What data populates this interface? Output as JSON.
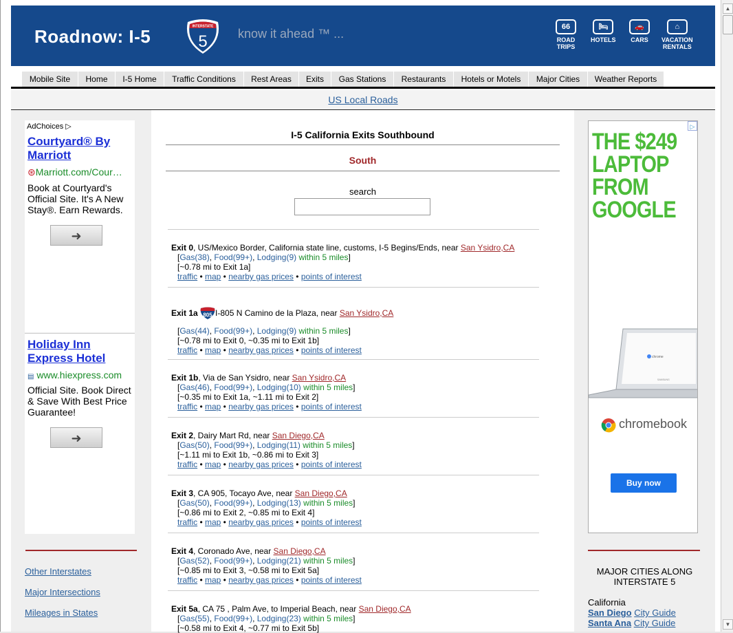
{
  "header": {
    "title": "Roadnow: I-5",
    "shield_label": "INTERSTATE",
    "shield_number": "5",
    "tagline": "know it ahead ™ ...",
    "icons": [
      {
        "label1": "ROAD",
        "label2": "TRIPS",
        "glyph": "66"
      },
      {
        "label1": "HOTELS",
        "label2": "",
        "glyph": "🛏"
      },
      {
        "label1": "CARS",
        "label2": "",
        "glyph": "🚗"
      },
      {
        "label1": "VACATION",
        "label2": "RENTALS",
        "glyph": "⌂"
      }
    ]
  },
  "nav": [
    "Mobile Site",
    "Home",
    "I-5 Home",
    "Traffic Conditions",
    "Rest Areas",
    "Exits",
    "Gas Stations",
    "Restaurants",
    "Hotels or Motels",
    "Major Cities",
    "Weather Reports"
  ],
  "local_roads": "US Local Roads",
  "left_ads": {
    "adchoices": "AdChoices",
    "ad1": {
      "title": "Courtyard® By Marriott",
      "url": "Marriott.com/Cour…",
      "text": "Book at Courtyard's Official Site. It's A New Stay®. Earn Rewards.",
      "button": "➜"
    },
    "ad2": {
      "title": "Holiday Inn Express Hotel",
      "url": "www.hiexpress.com",
      "text": "Official Site. Book Direct & Save With Best Price Guarantee!",
      "button": "➜"
    }
  },
  "left_links": [
    "Other Interstates",
    "Major Intersections",
    "Mileages in States"
  ],
  "main": {
    "title": "I-5 California Exits Southbound",
    "direction": "South",
    "search_label": "search",
    "search_value": ""
  },
  "exits": [
    {
      "num": "Exit 0",
      "desc": ", US/Mexico Border, California state line, customs, I-5 Begins/Ends, near ",
      "near": "San Ysidro,CA",
      "gas": "Gas(38)",
      "food": "Food(99+)",
      "lodging": "Lodging(9)",
      "within": " within 5 miles",
      "dist": "[~0.78 mi to Exit 1a]"
    },
    {
      "num": "Exit 1a",
      "desc": "I-805 N Camino de la Plaza, near ",
      "near": "San Ysidro,CA",
      "gas": "Gas(44)",
      "food": "Food(99+)",
      "lodging": "Lodging(9)",
      "within": " within 5 miles",
      "dist": "[~0.78 mi to Exit 0, ~0.35 mi to Exit 1b]",
      "shield": "805"
    },
    {
      "num": "Exit 1b",
      "desc": ", Via de San Ysidro, near ",
      "near": "San Ysidro,CA",
      "gas": "Gas(46)",
      "food": "Food(99+)",
      "lodging": "Lodging(10)",
      "within": " within 5 miles",
      "dist": "[~0.35 mi to Exit 1a, ~1.11 mi to Exit 2]"
    },
    {
      "num": "Exit 2",
      "desc": ", Dairy Mart Rd, near ",
      "near": "San Diego,CA",
      "gas": "Gas(50)",
      "food": "Food(99+)",
      "lodging": "Lodging(11)",
      "within": " within 5 miles",
      "dist": "[~1.11 mi to Exit 1b, ~0.86 mi to Exit 3]"
    },
    {
      "num": "Exit 3",
      "desc": ", CA 905, Tocayo Ave, near ",
      "near": "San Diego,CA",
      "gas": "Gas(50)",
      "food": "Food(99+)",
      "lodging": "Lodging(13)",
      "within": " within 5 miles",
      "dist": "[~0.86 mi to Exit 2, ~0.85 mi to Exit 4]"
    },
    {
      "num": "Exit 4",
      "desc": ", Coronado Ave, near ",
      "near": "San Diego,CA",
      "gas": "Gas(52)",
      "food": "Food(99+)",
      "lodging": "Lodging(21)",
      "within": " within 5 miles",
      "dist": "[~0.85 mi to Exit 3, ~0.58 mi to Exit 5a]"
    },
    {
      "num": "Exit 5a",
      "desc": ", CA 75 , Palm Ave, to Imperial Beach, near ",
      "near": "San Diego,CA",
      "gas": "Gas(55)",
      "food": "Food(99+)",
      "lodging": "Lodging(23)",
      "within": " within 5 miles",
      "dist": "[~0.58 mi to Exit 4, ~0.77 mi to Exit 5b]"
    }
  ],
  "exit_links": [
    "traffic",
    "map",
    "nearby gas prices",
    "points of interest"
  ],
  "right_ad": {
    "headline": "THE $249 LAPTOP FROM GOOGLE",
    "brand": "chromebook",
    "button": "Buy now",
    "screen_text": "chrome",
    "maker": "SAMSUNG"
  },
  "major_cities": {
    "heading": "MAJOR CITIES ALONG INTERSTATE 5",
    "state": "California",
    "cities": [
      {
        "name": "San Diego",
        "guide": "City Guide"
      },
      {
        "name": "Santa Ana",
        "guide": "City Guide"
      }
    ]
  },
  "colors": {
    "header_bg": "#15498c",
    "link": "#2a5f9b",
    "near": "#a0282a",
    "green": "#1a8c29"
  }
}
